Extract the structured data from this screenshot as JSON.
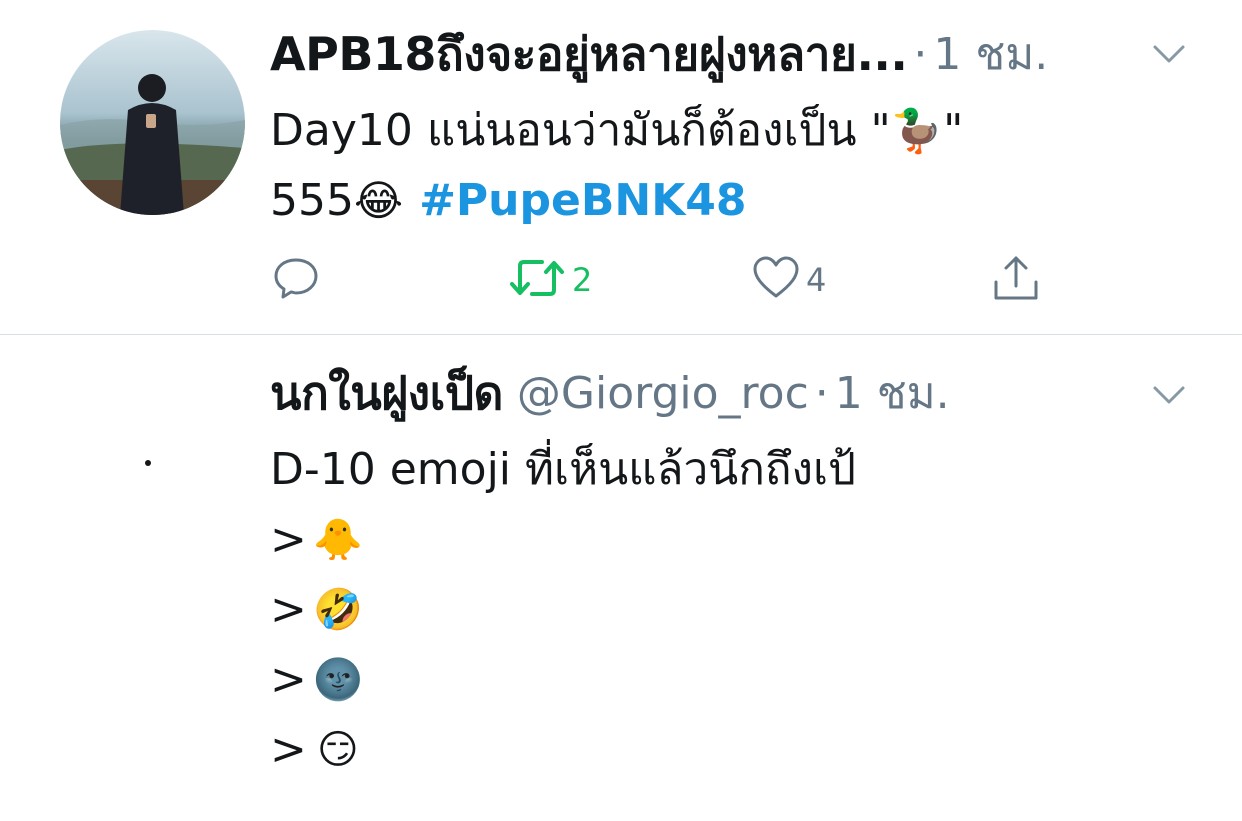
{
  "tweet1": {
    "name": "APB18ถึงจะอยู่หลายฝูงหลาย...",
    "dot": "·",
    "time": "1 ชม.",
    "line1_text": "Day10 แน่นอนว่ามันก็ต้องเป็น \"",
    "line1_emoji": "🦆",
    "line1_end": "\"",
    "line2_text": "555",
    "line2_emoji": "😂",
    "hashtag": "#PupeBNK48",
    "retweet_count": "2",
    "like_count": "4"
  },
  "tweet2": {
    "name": "นกในฝูงเป็ด",
    "handle": "@Giorgio_roc",
    "dot": "·",
    "time": "1 ชม.",
    "line1": "D-10 emoji ที่เห็นแล้วนึกถึงเป้",
    "items": [
      {
        "prefix": ">",
        "emoji": "🐥"
      },
      {
        "prefix": ">",
        "emoji": "🤣"
      },
      {
        "prefix": ">",
        "emoji": "🌚"
      },
      {
        "prefix": ">",
        "emoji": "😏"
      }
    ]
  },
  "colors": {
    "link": "#1b95e0",
    "retweet_active": "#17bf63",
    "secondary": "#657786",
    "divider": "#d9dee3"
  },
  "icons": [
    "chevron-down-icon",
    "reply-icon",
    "retweet-icon",
    "like-icon",
    "share-icon"
  ]
}
